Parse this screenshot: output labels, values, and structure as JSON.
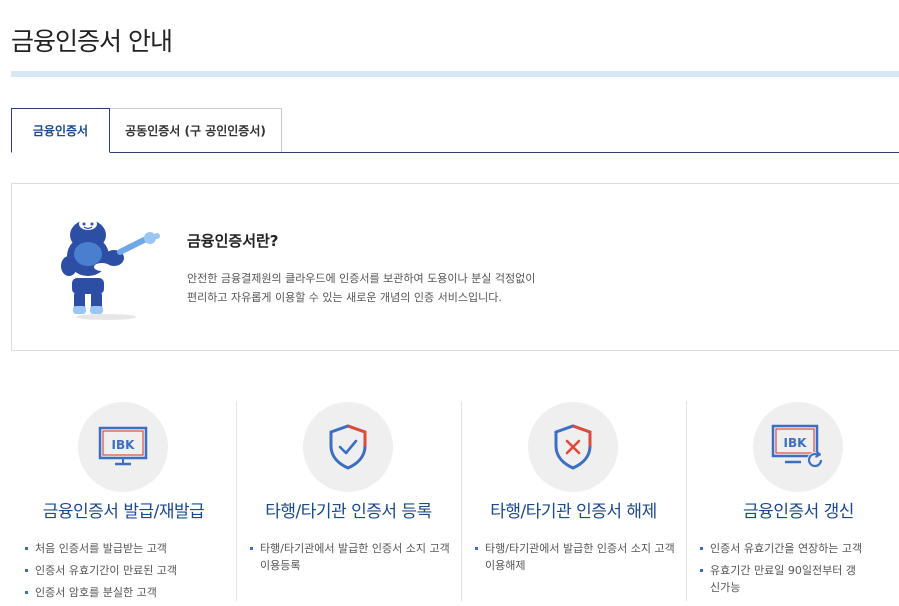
{
  "page": {
    "title": "금융인증서 안내"
  },
  "tabs": [
    {
      "label": "금융인증서",
      "active": true
    },
    {
      "label": "공동인증서 (구 공인인증서)",
      "active": false
    }
  ],
  "intro": {
    "heading": "금융인증서란?",
    "lines": [
      "안전한 금융결제원의 클라우드에 인증서를 보관하여 도용이나 분실 걱정없이",
      "편리하고 자유롭게 이용할 수 있는 새로운 개념의 인증 서비스입니다."
    ]
  },
  "services": [
    {
      "icon": "ibk-monitor-icon",
      "icon_text": "IBK",
      "title": "금융인증서 발급/재발급",
      "bullets": [
        "처음 인증서를 발급받는 고객",
        "인증서 유효기간이 만료된 고객",
        "인증서 암호를 분실한 고객"
      ]
    },
    {
      "icon": "shield-check-icon",
      "title": "타행/타기관 인증서 등록",
      "bullets": [
        "타행/타기관에서 발급한 인증서 소지 고객 이용등록"
      ]
    },
    {
      "icon": "shield-x-icon",
      "title": "타행/타기관 인증서 해제",
      "bullets": [
        "타행/타기관에서 발급한 인증서 소지 고객 이용해제"
      ]
    },
    {
      "icon": "ibk-monitor-refresh-icon",
      "icon_text": "IBK",
      "title": "금융인증서 갱신",
      "bullets": [
        "인증서 유효기간을 연장하는 고객",
        "유효기간 만료일 90일전부터 갱신가능"
      ]
    }
  ],
  "colors": {
    "accent": "#1b4a8b",
    "tab_line": "#2e3f72",
    "title_bar": "#d5e8f4",
    "icon_blue": "#3c6fc2",
    "icon_red": "#e04a3a"
  }
}
